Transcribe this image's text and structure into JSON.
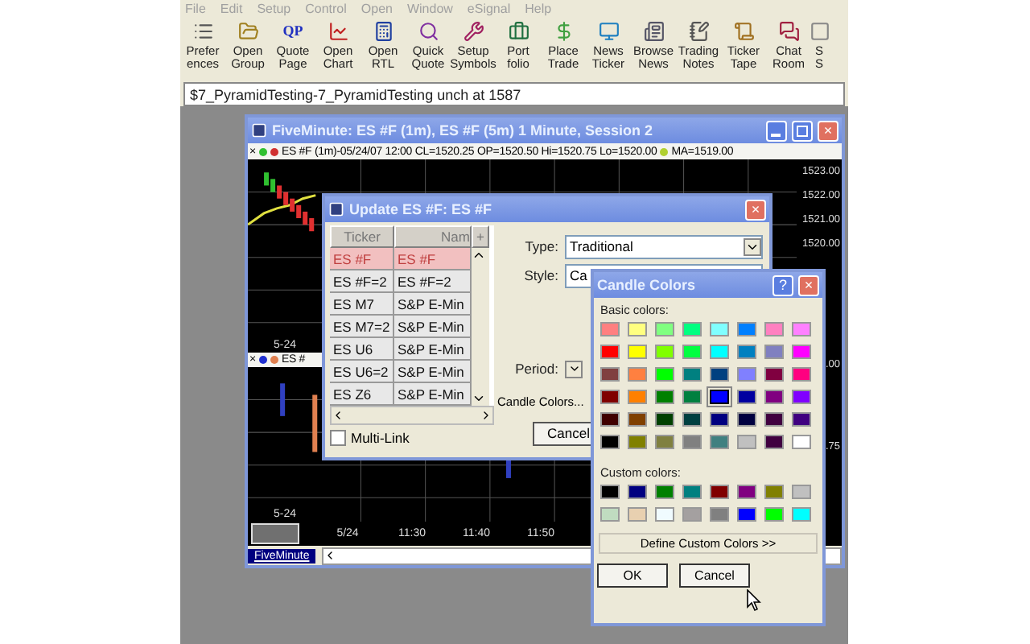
{
  "menu": [
    "File",
    "Edit",
    "Setup",
    "Control",
    "Open",
    "Window",
    "eSignal",
    "Help"
  ],
  "toolbar": [
    {
      "lines": [
        "Prefer",
        "ences"
      ]
    },
    {
      "lines": [
        "Open",
        "Group"
      ]
    },
    {
      "lines": [
        "Quote",
        "Page"
      ],
      "icon_text": "QP"
    },
    {
      "lines": [
        "Open",
        "Chart"
      ]
    },
    {
      "lines": [
        "Open",
        "RTL"
      ]
    },
    {
      "lines": [
        "Quick",
        "Quote"
      ]
    },
    {
      "lines": [
        "Setup",
        "Symbols"
      ]
    },
    {
      "lines": [
        "Port",
        "folio"
      ]
    },
    {
      "lines": [
        "Place",
        "Trade"
      ]
    },
    {
      "lines": [
        "News",
        "Ticker"
      ]
    },
    {
      "lines": [
        "Browse",
        "News"
      ]
    },
    {
      "lines": [
        "Trading",
        "Notes"
      ]
    },
    {
      "lines": [
        "Ticker",
        "Tape"
      ]
    },
    {
      "lines": [
        "Chat",
        "Room"
      ]
    },
    {
      "lines": [
        "S",
        "S"
      ]
    }
  ],
  "symbol_line": "$7_PyramidTesting-7_PyramidTesting unch at 1587",
  "chart_window": {
    "title": "FiveMinute: ES #F (1m), ES #F (5m) 1 Minute, Session 2",
    "close_glyph": "×",
    "info": "ES #F (1m)-05/24/07 12:00 CL=1520.25 OP=1520.50 Hi=1520.75 Lo=1520.00",
    "ma": "MA=1519.00",
    "upper_axis": [
      "1523.00",
      "1522.00",
      "1521.00",
      "1520.00"
    ],
    "upper_date": "5-24",
    "lower_info": "ES #",
    "lower_axis": [
      ".00",
      ".75"
    ],
    "lower_date": "5-24",
    "time_labels": [
      "5/24",
      "11:30",
      "11:40",
      "11:50"
    ],
    "tab": "FiveMinute"
  },
  "update_dialog": {
    "title": "Update ES #F: ES #F",
    "columns": [
      "Ticker",
      "Nam"
    ],
    "add_column": "+",
    "rows": [
      {
        "ticker": "ES #F",
        "name": "ES #F",
        "selected": true
      },
      {
        "ticker": "ES #F=2",
        "name": "ES #F=2",
        "selected": false
      },
      {
        "ticker": "ES M7",
        "name": "S&P E-Min",
        "selected": false
      },
      {
        "ticker": "ES M7=2",
        "name": "S&P E-Min",
        "selected": false
      },
      {
        "ticker": "ES U6",
        "name": "S&P E-Min",
        "selected": false
      },
      {
        "ticker": "ES U6=2",
        "name": "S&P E-Min",
        "selected": false
      },
      {
        "ticker": "ES Z6",
        "name": "S&P E-Min",
        "selected": false
      }
    ],
    "multi_link": {
      "label": "Multi-Link",
      "checked": false
    },
    "type_label": "Type:",
    "type_value": "Traditional",
    "style_label": "Style:",
    "style_value": "Ca",
    "period_label": "Period:",
    "candle_colors_label": "Candle Colors...",
    "cancel": "Cancel"
  },
  "color_dialog": {
    "title": "Candle Colors",
    "help": "?",
    "basic_label": "Basic colors:",
    "basic": [
      {
        "color": "#ff8080",
        "selected": false
      },
      {
        "color": "#ffff80",
        "selected": false
      },
      {
        "color": "#80ff80",
        "selected": false
      },
      {
        "color": "#00ff80",
        "selected": false
      },
      {
        "color": "#80ffff",
        "selected": false
      },
      {
        "color": "#0080ff",
        "selected": false
      },
      {
        "color": "#ff80c0",
        "selected": false
      },
      {
        "color": "#ff80ff",
        "selected": false
      },
      {
        "color": "#ff0000",
        "selected": false
      },
      {
        "color": "#ffff00",
        "selected": false
      },
      {
        "color": "#80ff00",
        "selected": false
      },
      {
        "color": "#00ff40",
        "selected": false
      },
      {
        "color": "#00ffff",
        "selected": false
      },
      {
        "color": "#0080c0",
        "selected": false
      },
      {
        "color": "#8080c0",
        "selected": false
      },
      {
        "color": "#ff00ff",
        "selected": false
      },
      {
        "color": "#804040",
        "selected": false
      },
      {
        "color": "#ff8040",
        "selected": false
      },
      {
        "color": "#00ff00",
        "selected": false
      },
      {
        "color": "#008080",
        "selected": false
      },
      {
        "color": "#004080",
        "selected": false
      },
      {
        "color": "#8080ff",
        "selected": false
      },
      {
        "color": "#800040",
        "selected": false
      },
      {
        "color": "#ff0080",
        "selected": false
      },
      {
        "color": "#800000",
        "selected": false
      },
      {
        "color": "#ff8000",
        "selected": false
      },
      {
        "color": "#008000",
        "selected": false
      },
      {
        "color": "#008040",
        "selected": false
      },
      {
        "color": "#0000ff",
        "selected": true
      },
      {
        "color": "#0000a0",
        "selected": false
      },
      {
        "color": "#800080",
        "selected": false
      },
      {
        "color": "#8000ff",
        "selected": false
      },
      {
        "color": "#400000",
        "selected": false
      },
      {
        "color": "#804000",
        "selected": false
      },
      {
        "color": "#004000",
        "selected": false
      },
      {
        "color": "#004040",
        "selected": false
      },
      {
        "color": "#000080",
        "selected": false
      },
      {
        "color": "#000040",
        "selected": false
      },
      {
        "color": "#400040",
        "selected": false
      },
      {
        "color": "#400080",
        "selected": false
      },
      {
        "color": "#000000",
        "selected": false
      },
      {
        "color": "#808000",
        "selected": false
      },
      {
        "color": "#808040",
        "selected": false
      },
      {
        "color": "#808080",
        "selected": false
      },
      {
        "color": "#408080",
        "selected": false
      },
      {
        "color": "#c0c0c0",
        "selected": false
      },
      {
        "color": "#400040",
        "selected": false
      },
      {
        "color": "#ffffff",
        "selected": false
      }
    ],
    "custom_label": "Custom colors:",
    "custom": [
      {
        "color": "#000000"
      },
      {
        "color": "#000080"
      },
      {
        "color": "#008000"
      },
      {
        "color": "#008080"
      },
      {
        "color": "#800000"
      },
      {
        "color": "#800080"
      },
      {
        "color": "#808000"
      },
      {
        "color": "#c0c0c0"
      },
      {
        "color": "#c0dcc0"
      },
      {
        "color": "#e8d0b0"
      },
      {
        "color": "#f0fbff"
      },
      {
        "color": "#a4a0a0"
      },
      {
        "color": "#808080"
      },
      {
        "color": "#0000ff"
      },
      {
        "color": "#00ff00"
      },
      {
        "color": "#00ffff"
      }
    ],
    "define_button": "Define Custom Colors >>",
    "ok": "OK",
    "cancel": "Cancel"
  }
}
